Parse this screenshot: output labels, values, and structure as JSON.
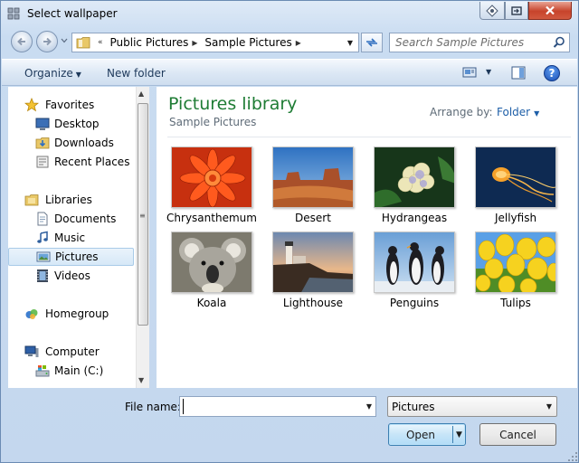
{
  "window": {
    "title": "Select wallpaper",
    "title_icon": "dialog-icon",
    "controls": [
      "help-icon",
      "restore-icon",
      "close-icon"
    ]
  },
  "address_bar": {
    "prefix": "«",
    "breadcrumbs": [
      "Public Pictures",
      "Sample Pictures"
    ],
    "search_placeholder": "Search Sample Pictures"
  },
  "command_bar": {
    "organize_label": "Organize",
    "new_folder_label": "New folder",
    "help_label": "?"
  },
  "nav_pane": {
    "items": [
      {
        "label": "Favorites",
        "icon": "star-icon",
        "level": 0
      },
      {
        "label": "Desktop",
        "icon": "desktop-icon",
        "level": 1
      },
      {
        "label": "Downloads",
        "icon": "downloads-folder-icon",
        "level": 1
      },
      {
        "label": "Recent Places",
        "icon": "recent-places-icon",
        "level": 1
      },
      {
        "label": "Libraries",
        "icon": "libraries-icon",
        "level": 0
      },
      {
        "label": "Documents",
        "icon": "documents-icon",
        "level": 1
      },
      {
        "label": "Music",
        "icon": "music-icon",
        "level": 1
      },
      {
        "label": "Pictures",
        "icon": "pictures-icon",
        "level": 1,
        "selected": true
      },
      {
        "label": "Videos",
        "icon": "videos-icon",
        "level": 1
      },
      {
        "label": "Homegroup",
        "icon": "homegroup-icon",
        "level": 0
      },
      {
        "label": "Computer",
        "icon": "computer-icon",
        "level": 0
      },
      {
        "label": "Main (C:)",
        "icon": "drive-icon",
        "level": 1
      }
    ]
  },
  "content": {
    "library_title": "Pictures library",
    "library_subtitle": "Sample Pictures",
    "arrange_label": "Arrange by:",
    "arrange_value": "Folder",
    "thumbnails": [
      {
        "label": "Chrysanthemum"
      },
      {
        "label": "Desert"
      },
      {
        "label": "Hydrangeas"
      },
      {
        "label": "Jellyfish"
      },
      {
        "label": "Koala"
      },
      {
        "label": "Lighthouse"
      },
      {
        "label": "Penguins"
      },
      {
        "label": "Tulips"
      }
    ]
  },
  "footer": {
    "file_name_label": "File name:",
    "file_name_value": "",
    "file_type_value": "Pictures",
    "open_label": "Open",
    "cancel_label": "Cancel"
  }
}
